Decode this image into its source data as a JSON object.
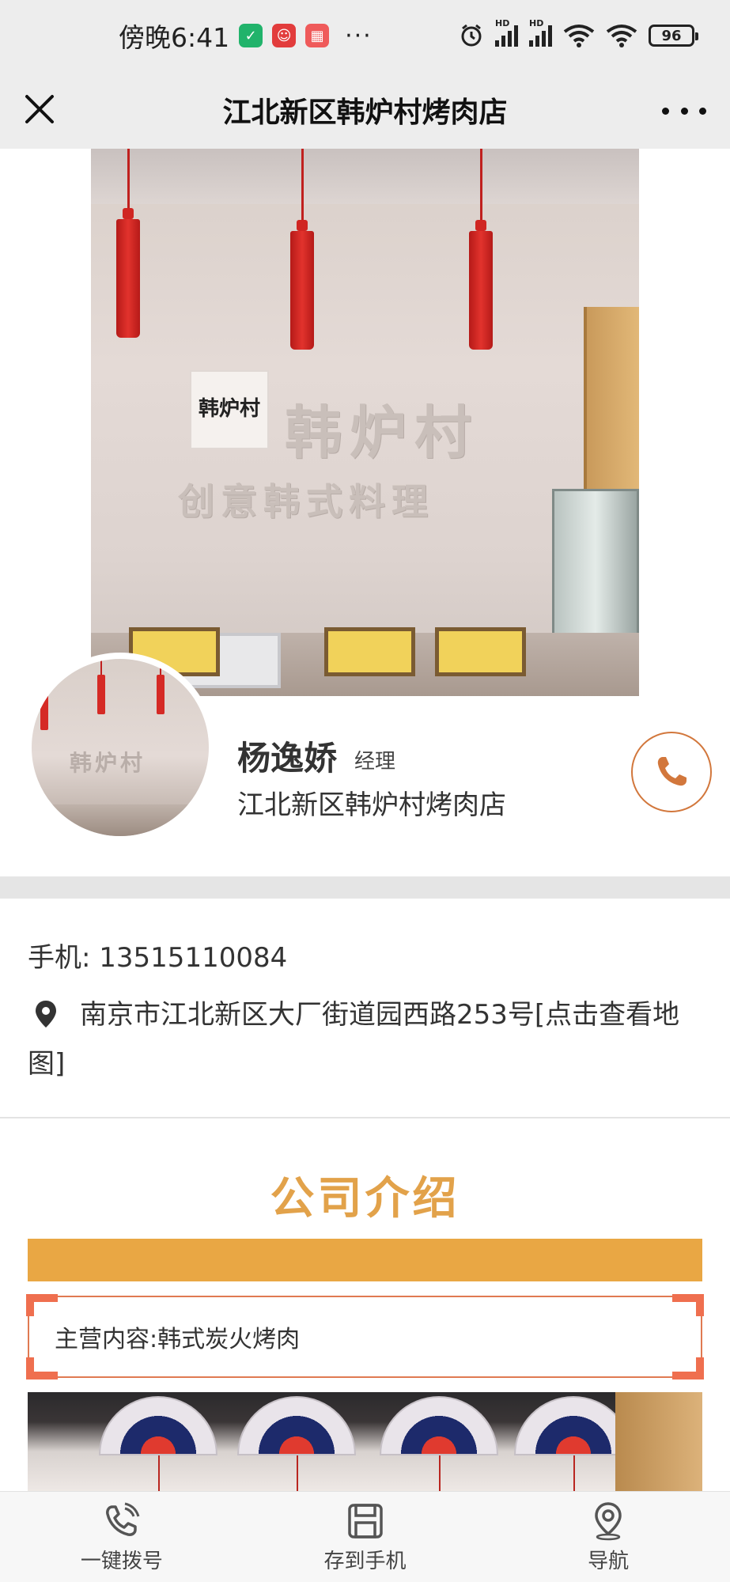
{
  "status_bar": {
    "time": "傍晚6:41",
    "battery": "96",
    "more": "···"
  },
  "nav": {
    "title": "江北新区韩炉村烤肉店"
  },
  "hero": {
    "logo_text": "韩炉村",
    "wall_text_main": "韩炉村",
    "wall_text_sub": "创意韩式料理"
  },
  "profile": {
    "name": "杨逸娇",
    "role": "经理",
    "company": "江北新区韩炉村烤肉店"
  },
  "contact": {
    "phone_label": "手机:",
    "phone_value": "13515110084",
    "address": "南京市江北新区大厂街道园西路253号[点击查看地图]"
  },
  "intro": {
    "title": "公司介绍",
    "business": "主营内容:韩式炭火烤肉"
  },
  "bottom_bar": {
    "items": [
      {
        "label": "一键拨号",
        "icon": "phone-icon"
      },
      {
        "label": "存到手机",
        "icon": "save-icon"
      },
      {
        "label": "导航",
        "icon": "navigation-pin-icon"
      }
    ]
  },
  "colors": {
    "accent": "#e2a24a",
    "call_orange": "#d2773c",
    "frame_red": "#ef6f4f"
  }
}
